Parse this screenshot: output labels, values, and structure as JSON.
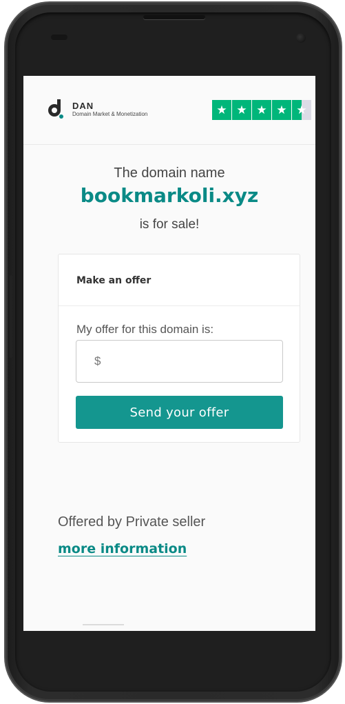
{
  "brand": {
    "name": "DAN",
    "tagline": "Domain Market & Monetization",
    "accent_color": "#0a8a86",
    "button_color": "#14968f",
    "rating_color": "#00b67a"
  },
  "rating": {
    "stars_display": "★",
    "value_out_of_5": 4.5
  },
  "hero": {
    "intro": "The domain name",
    "domain": "bookmarkoli.xyz",
    "status": "is for sale!"
  },
  "offer_card": {
    "title": "Make an offer",
    "label": "My offer for this domain is:",
    "input_placeholder": "$",
    "input_value": "",
    "submit_label": "Send your offer"
  },
  "seller": {
    "offered_by": "Offered by Private seller",
    "more_info_link": "more information"
  }
}
